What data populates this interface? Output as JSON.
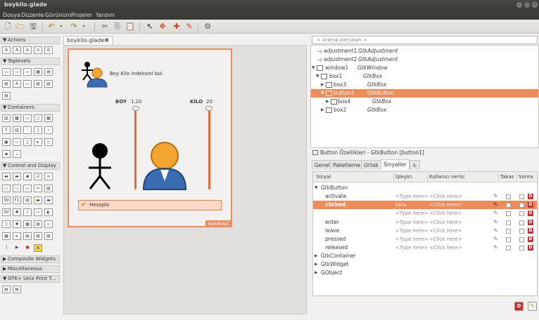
{
  "window": {
    "title": "boykilo.glade"
  },
  "menu": [
    "Dosya",
    "Düzenle",
    "Görünüm",
    "Projeler",
    "Yardım"
  ],
  "palette": {
    "groups": [
      {
        "label": "Actions",
        "expanded": true
      },
      {
        "label": "Toplevels",
        "expanded": true
      },
      {
        "label": "Containers",
        "expanded": true
      },
      {
        "label": "Control and Display",
        "expanded": true
      },
      {
        "label": "Composite Widgets",
        "expanded": false
      },
      {
        "label": "Miscellaneous",
        "expanded": false
      },
      {
        "label": "GTK+ Unix Print T...",
        "expanded": false
      }
    ]
  },
  "document_tab": {
    "label": "boykilo.glade",
    "close": "✖"
  },
  "design": {
    "heading": "Boy Kilo indeksini bul",
    "boy_label": "BOY",
    "boy_value": "1,20",
    "kilo_label": "KİLO",
    "kilo_value": "20",
    "button_label": "Hesapla",
    "window_label": "window1"
  },
  "search": {
    "placeholder": "< arama parçaları >"
  },
  "tree": [
    {
      "name": "adjustment1",
      "class": "GtkAdjustment",
      "depth": 0,
      "expander": ""
    },
    {
      "name": "adjustment2",
      "class": "GtkAdjustment",
      "depth": 0,
      "expander": ""
    },
    {
      "name": "window1",
      "class": "GtkWindow",
      "depth": 0,
      "expander": "▼"
    },
    {
      "name": "box1",
      "class": "GtkBox",
      "depth": 1,
      "expander": "▼"
    },
    {
      "name": "box3",
      "class": "GtkBox",
      "depth": 2,
      "expander": "▶"
    },
    {
      "name": "button1",
      "class": "GtkButton",
      "depth": 2,
      "expander": "▼",
      "selected": true
    },
    {
      "name": "box4",
      "class": "GtkBox",
      "depth": 3,
      "expander": "▶"
    },
    {
      "name": "box2",
      "class": "GtkBox",
      "depth": 2,
      "expander": "▶"
    }
  ],
  "properties": {
    "title": "Button Özellikleri - GtkButton [button1]",
    "tabs": [
      "Genel",
      "Paketleme",
      "Ortak",
      "Sinyaller"
    ],
    "active_tab": "Sinyaller"
  },
  "signals": {
    "headers": {
      "signal": "Sinyal",
      "handler": "İşleyici",
      "user_data": "Kullanıcı verisi",
      "swap": "Takas",
      "after": "Sonra"
    },
    "rows": [
      {
        "kind": "group",
        "name": "GtkButton",
        "expander": "▼"
      },
      {
        "kind": "signal",
        "name": "activate",
        "handler": "<Type here>",
        "data": "<Click here>"
      },
      {
        "kind": "signal",
        "name": "clicked",
        "handler": "tıkla",
        "data": "<Click here>",
        "selected": true
      },
      {
        "kind": "signal",
        "name": "",
        "handler": "<Type here>",
        "data": "<Click here>"
      },
      {
        "kind": "signal",
        "name": "enter",
        "handler": "<Type here>",
        "data": "<Click here>"
      },
      {
        "kind": "signal",
        "name": "leave",
        "handler": "<Type here>",
        "data": "<Click here>"
      },
      {
        "kind": "signal",
        "name": "pressed",
        "handler": "<Type here>",
        "data": "<Click here>"
      },
      {
        "kind": "signal",
        "name": "released",
        "handler": "<Type here>",
        "data": "<Click here>"
      },
      {
        "kind": "group",
        "name": "GtkContainer",
        "expander": "▶"
      },
      {
        "kind": "group",
        "name": "GtkWidget",
        "expander": "▶"
      },
      {
        "kind": "group",
        "name": "GObject",
        "expander": "▶"
      }
    ]
  },
  "colors": {
    "accent": "#ef8b5a",
    "titlebar": "#3c3b37",
    "delete": "#c8302c"
  }
}
